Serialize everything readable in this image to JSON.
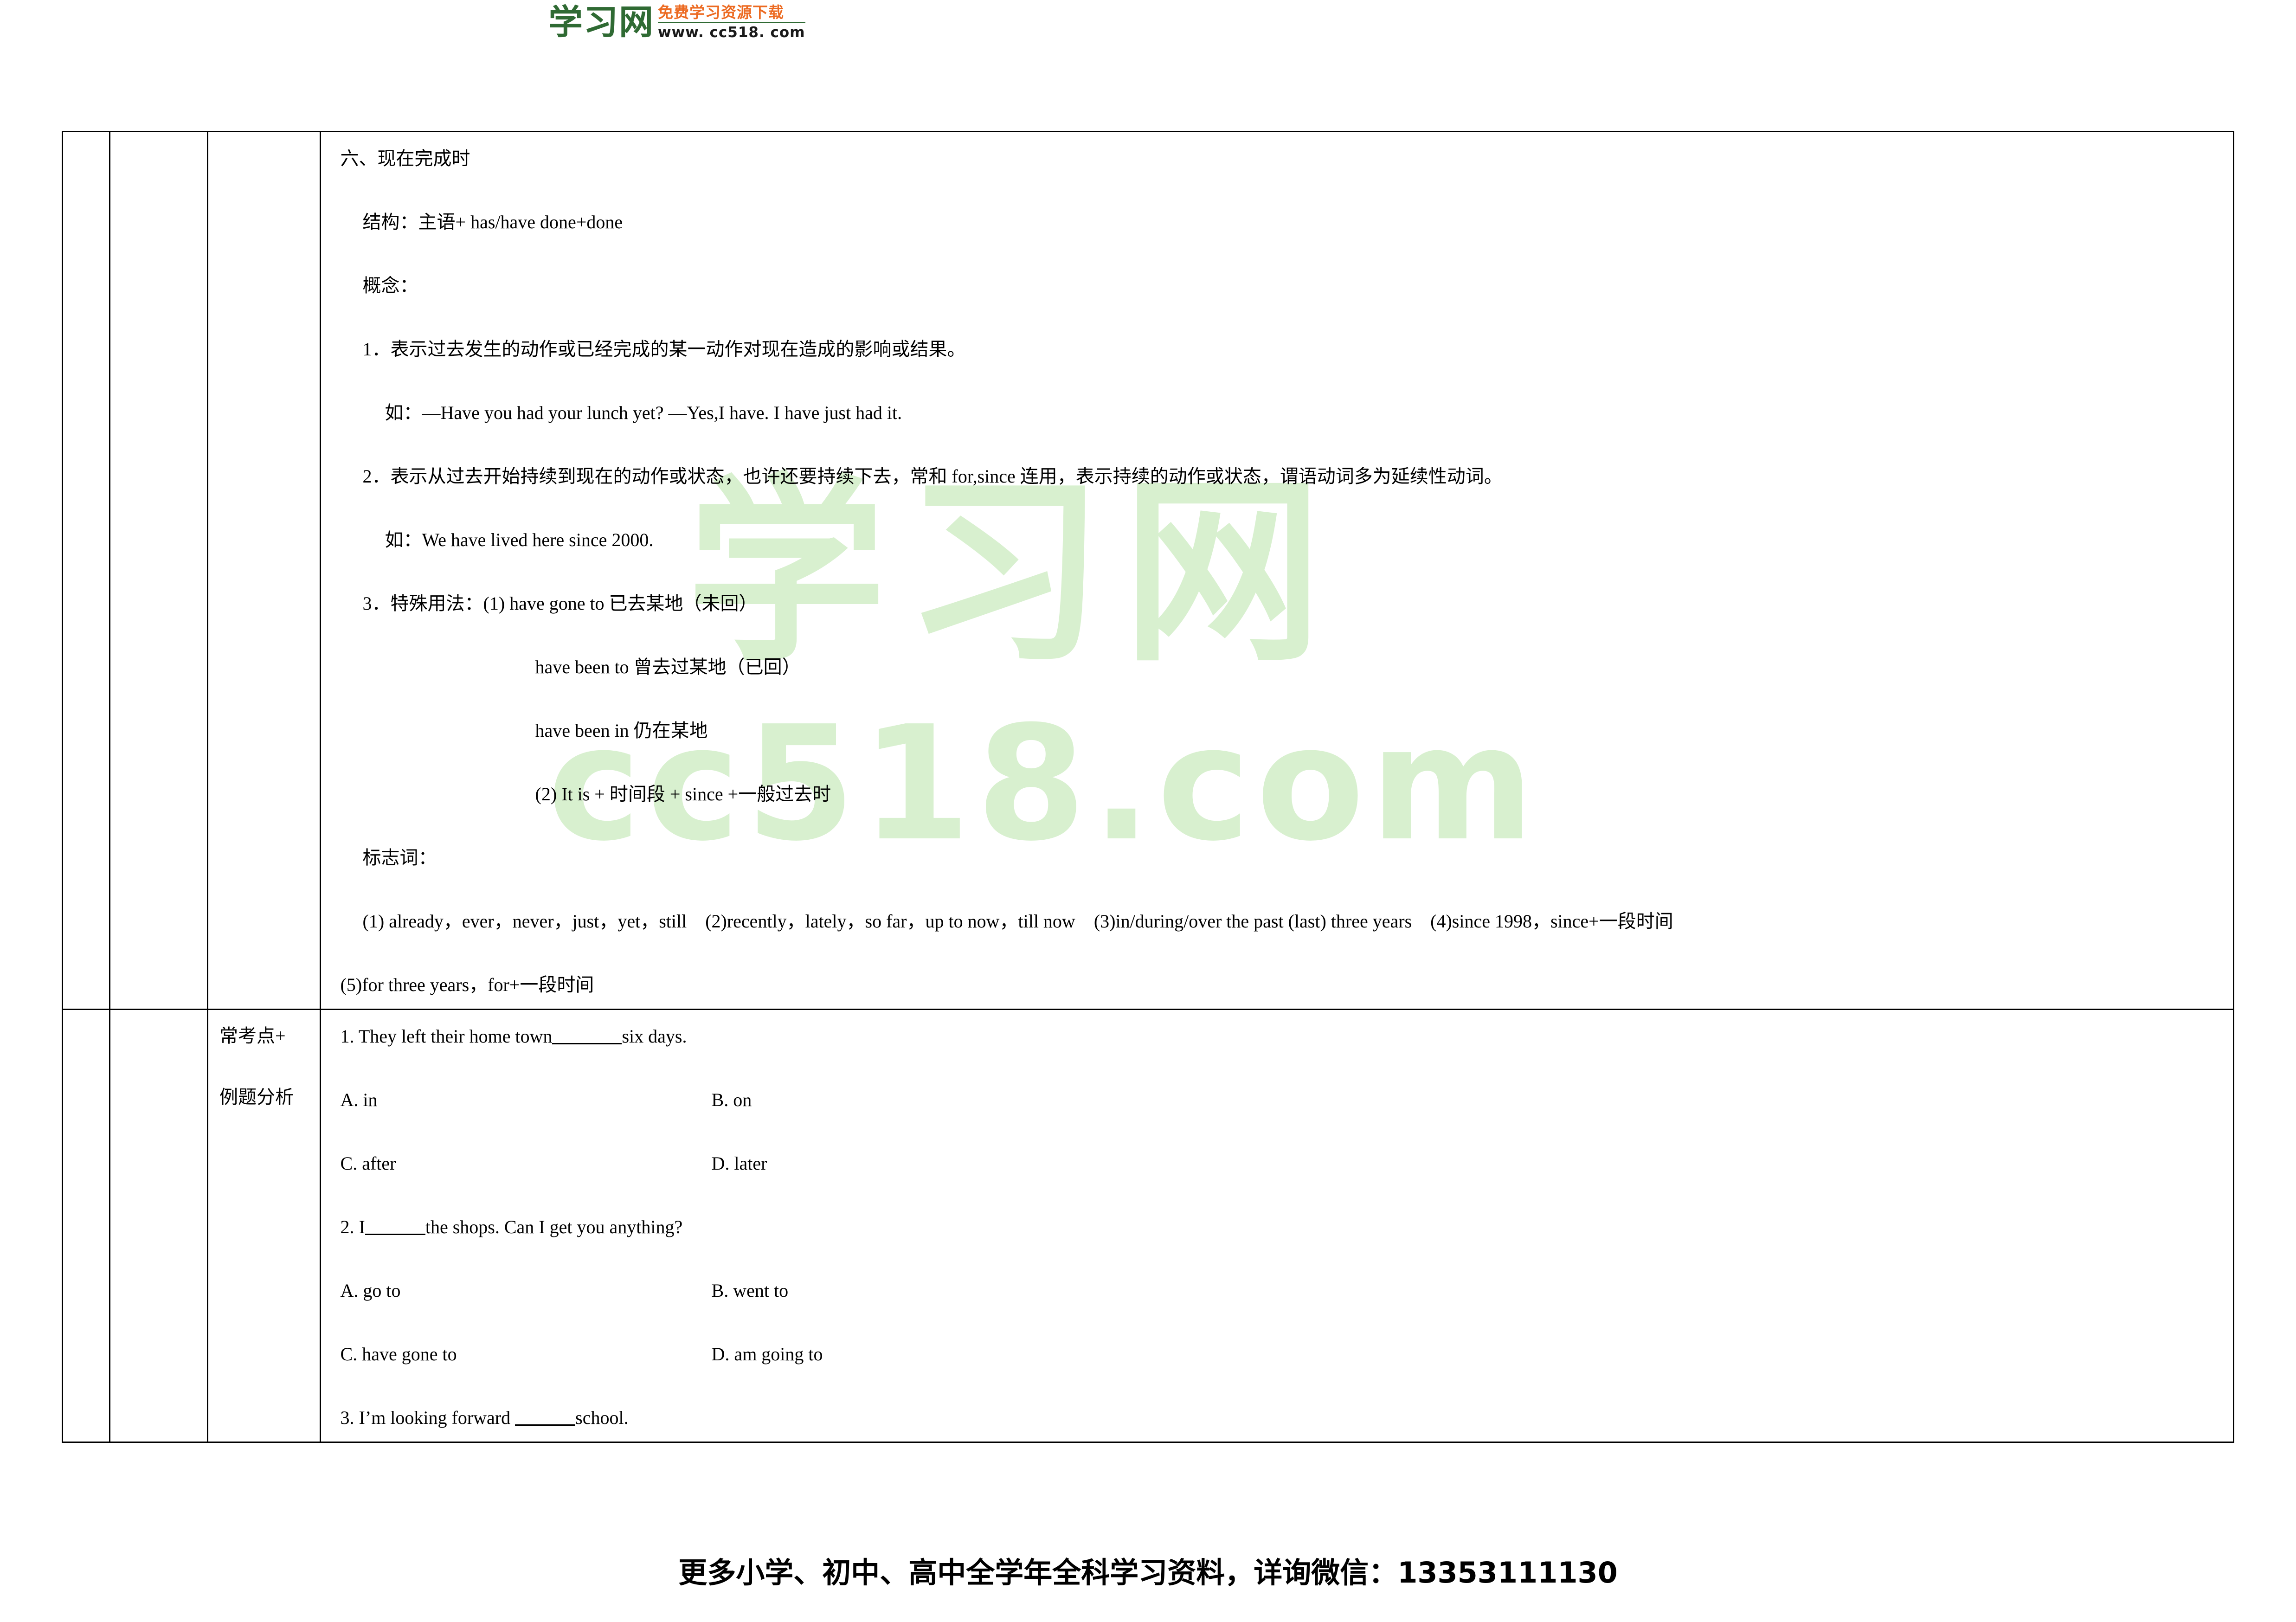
{
  "header": {
    "logo_cn": "学习网",
    "logo_tagline": "免费学习资源下载",
    "logo_url": "www. cc518. com"
  },
  "watermark": {
    "line1": "学习网",
    "line2": "cc518.com"
  },
  "table": {
    "row1": {
      "col_a": "",
      "col_b": "",
      "col_c": "",
      "content": {
        "heading": "六、现在完成时",
        "structure": "结构：主语+ has/have done+done",
        "concept_label": "概念：",
        "point1": "1．表示过去发生的动作或已经完成的某一动作对现在造成的影响或结果。",
        "example1": "如：—Have you had your lunch yet? —Yes,I have. I have just had it.",
        "point2": "2．表示从过去开始持续到现在的动作或状态，也许还要持续下去，常和 for,since 连用，表示持续的动作或状态，谓语动词多为延续性动词。",
        "example2": "如：We have lived here since 2000.",
        "point3": "3．特殊用法：(1) have gone to 已去某地（未回）",
        "point3_sub1": "have been to 曾去过某地（已回）",
        "point3_sub2": "have been in 仍在某地",
        "point3_sub3": "(2) It is + 时间段 + since +一般过去时",
        "signal_label": "标志词：",
        "signal_line1": "(1) already，ever，never，just，yet，still　(2)recently，lately，so far，up to now，till now　(3)in/during/over the past (last) three years　(4)since 1998，since+一段时间",
        "signal_line2": "(5)for three years，for+一段时间"
      }
    },
    "row2": {
      "col_a": "",
      "col_b": "",
      "label_line1": "常考点+",
      "label_line2": "例题分析",
      "questions": [
        {
          "stem_before": "1. They left their home town",
          "stem_after": "six days.",
          "option_a": "A. in",
          "option_b": "B. on",
          "option_c": "C. after",
          "option_d": "D. later"
        },
        {
          "stem_before": "2. I",
          "stem_after": "the shops. Can I get you anything?",
          "option_a": "A. go to",
          "option_b": "B. went to",
          "option_c": "C. have gone to",
          "option_d": "D. am going to"
        },
        {
          "stem_before": "3. I’m looking forward ",
          "stem_after": "school."
        }
      ]
    }
  },
  "footer": {
    "text": "更多小学、初中、高中全学年全科学习资料，详询微信：13353111130"
  }
}
